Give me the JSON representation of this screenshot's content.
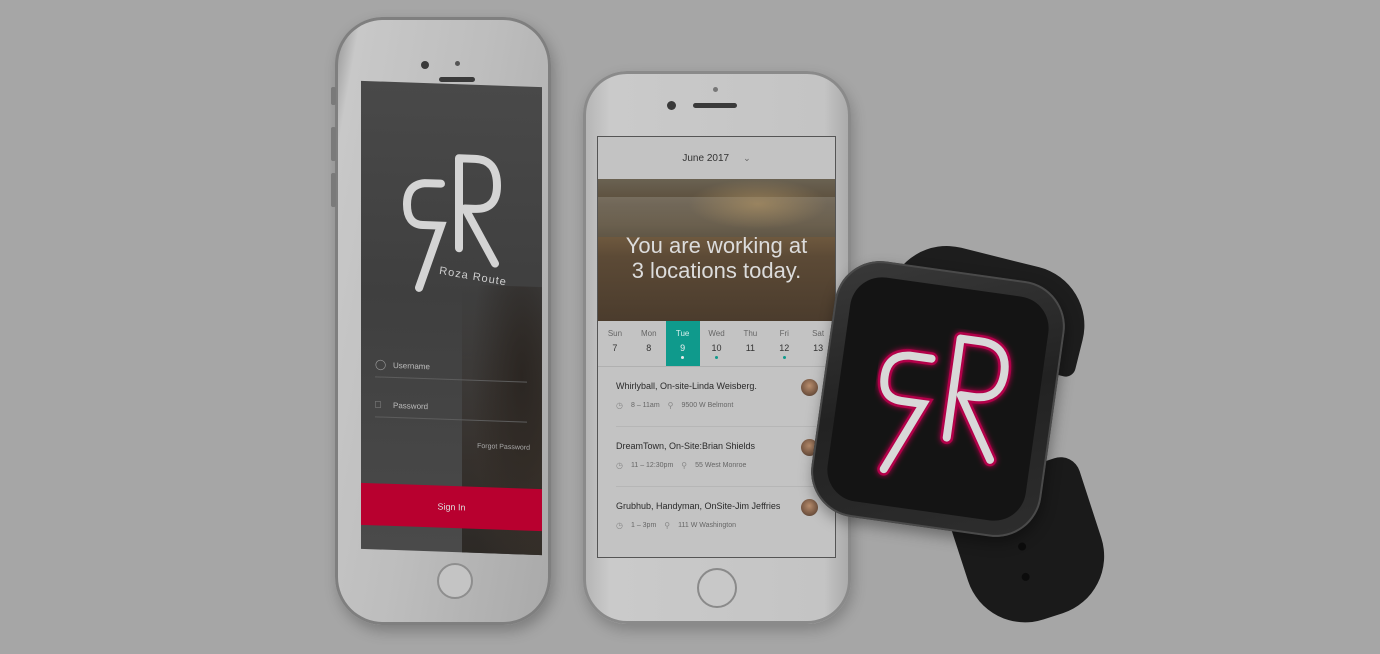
{
  "login_screen": {
    "brand": "Roza Route",
    "logo_letters": "RR",
    "username_placeholder": "Username",
    "password_placeholder": "Password",
    "forgot_password": "Forgot Password",
    "sign_in": "Sign In",
    "colors": {
      "sign_in_button": "#b8002f"
    }
  },
  "schedule_screen": {
    "month": "June 2017",
    "hero_line1": "You are working at",
    "hero_line2": "3 locations today.",
    "days": [
      {
        "name": "Sun",
        "num": "7"
      },
      {
        "name": "Mon",
        "num": "8"
      },
      {
        "name": "Tue",
        "num": "9"
      },
      {
        "name": "Wed",
        "num": "10"
      },
      {
        "name": "Thu",
        "num": "11"
      },
      {
        "name": "Fri",
        "num": "12"
      },
      {
        "name": "Sat",
        "num": "13"
      }
    ],
    "events": [
      {
        "title": "Whirlyball, On-site-Linda Weisberg.",
        "time": "8 – 11am",
        "location": "9500 W Belmont"
      },
      {
        "title": "DreamTown, On-Site:Brian Shields",
        "time": "11 – 12:30pm",
        "location": "55 West Monroe"
      },
      {
        "title": "Grubhub, Handyman, OnSite-Jim Jeffries",
        "time": "1 – 3pm",
        "location": "111 W Washington"
      }
    ],
    "colors": {
      "accent": "#0f9a8c"
    }
  },
  "watch": {
    "logo_letters": "RR",
    "colors": {
      "logo_glow": "#b3004a"
    }
  }
}
